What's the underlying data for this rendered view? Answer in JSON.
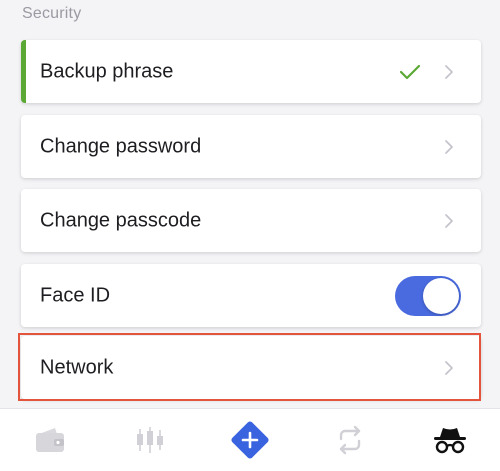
{
  "section": {
    "title": "Security"
  },
  "rows": [
    {
      "label": "Backup phrase",
      "status": "checked"
    },
    {
      "label": "Change password"
    },
    {
      "label": "Change passcode"
    },
    {
      "label": "Face ID",
      "toggle_on": true
    },
    {
      "label": "Network",
      "highlighted": true
    }
  ],
  "icons": {
    "check": "check-icon",
    "chevron": "chevron-right-icon"
  },
  "tabbar": {
    "items": [
      {
        "icon": "wallet-icon"
      },
      {
        "icon": "markets-candlestick-icon"
      },
      {
        "icon": "add-diamond-icon"
      },
      {
        "icon": "swap-icon"
      },
      {
        "icon": "incognito-icon",
        "active": true
      }
    ]
  },
  "colors": {
    "accent_green": "#5ba834",
    "toggle_blue": "#4a6be0",
    "highlight_red": "#e2553c",
    "add_button_blue": "#3a63e0"
  }
}
